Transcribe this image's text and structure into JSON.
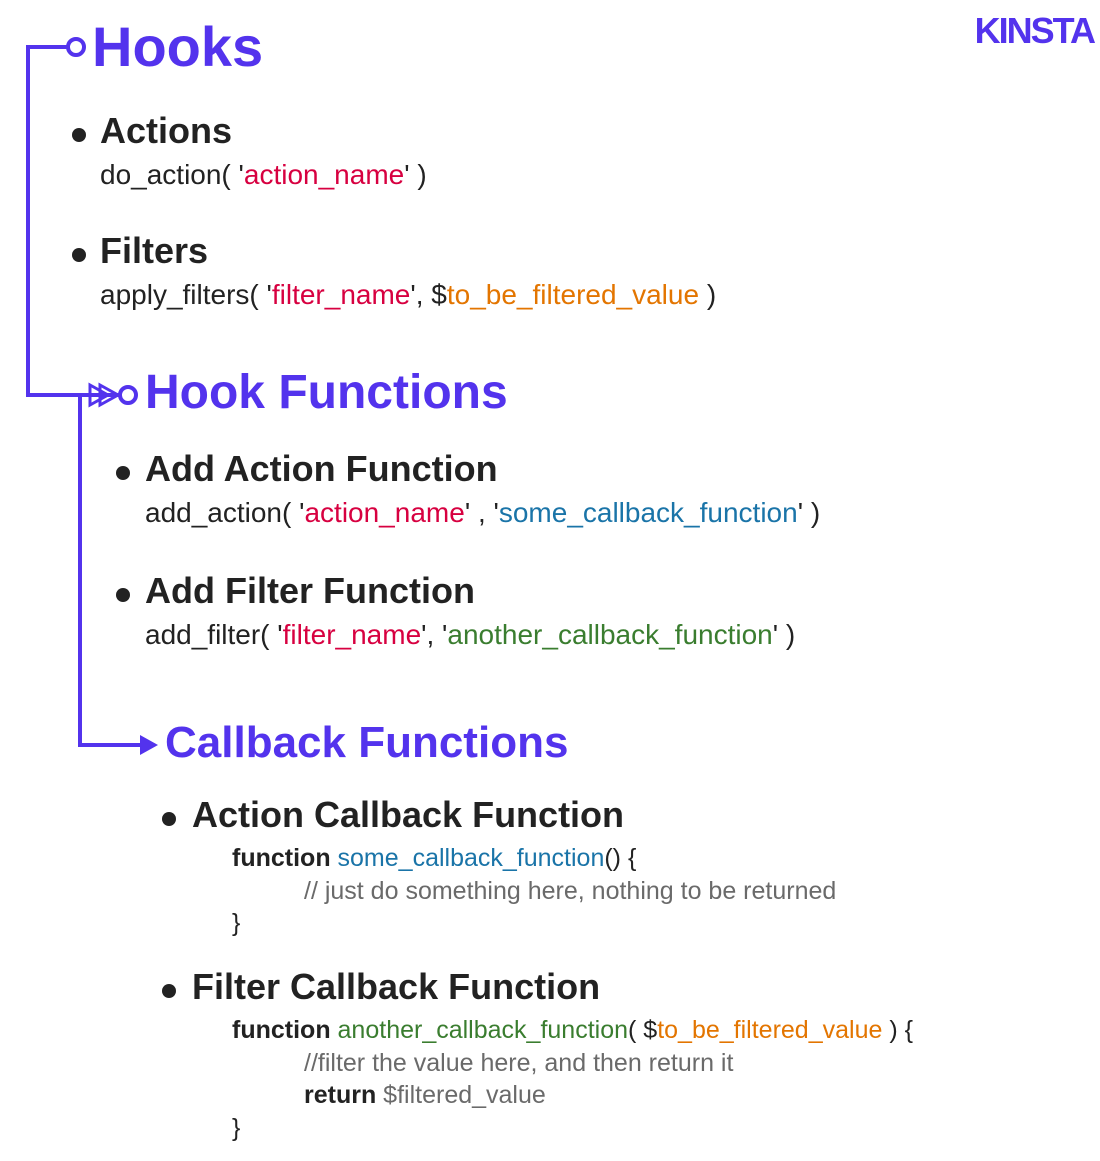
{
  "brand": "KINSTA",
  "hooks": {
    "title": "Hooks",
    "actions": {
      "title": "Actions",
      "fn": "do_action(",
      "q1": " '",
      "arg_action": "action_name",
      "q2": "' )"
    },
    "filters": {
      "title": "Filters",
      "fn": "apply_filters(",
      "q1": " '",
      "arg_filter": "filter_name",
      "q2": "', $",
      "arg_value": "to_be_filtered_value",
      "q3": " )"
    }
  },
  "hookfns": {
    "title": "Hook Functions",
    "add_action": {
      "title": "Add Action Function",
      "fn": "add_action(",
      "q1": " '",
      "arg1": "action_name",
      "mid": "' , '",
      "arg2": "some_callback_function",
      "end": "' )"
    },
    "add_filter": {
      "title": "Add Filter Function",
      "fn": "add_filter(",
      "q1": " '",
      "arg1": "filter_name",
      "mid": "', '",
      "arg2": "another_callback_function",
      "end": "' )"
    }
  },
  "callbacks": {
    "title": "Callback Functions",
    "action_cb": {
      "title": "Action Callback Function",
      "kw": "function ",
      "name": "some_callback_function",
      "sig_end": "() {",
      "body": "// just do something here, nothing to be returned",
      "close": "}"
    },
    "filter_cb": {
      "title": "Filter Callback Function",
      "kw": "function ",
      "name": "another_callback_function",
      "sig_open": "( $",
      "arg": "to_be_filtered_value",
      "sig_close": " ) {",
      "body1": "//filter the value here, and then return it",
      "ret_kw": "return",
      "ret_val": " $filtered_value",
      "close": "}"
    }
  }
}
